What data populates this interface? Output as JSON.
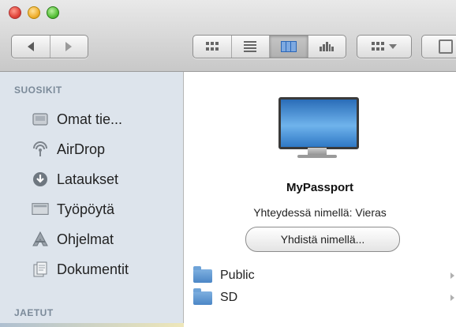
{
  "sidebar": {
    "favorites_header": "SUOSIKIT",
    "shared_header": "JAETUT",
    "items": [
      {
        "label": "Omat tie...",
        "icon": "home-icon"
      },
      {
        "label": "AirDrop",
        "icon": "airdrop-icon"
      },
      {
        "label": "Lataukset",
        "icon": "downloads-icon"
      },
      {
        "label": "Työpöytä",
        "icon": "desktop-icon"
      },
      {
        "label": "Ohjelmat",
        "icon": "applications-icon"
      },
      {
        "label": "Dokumentit",
        "icon": "documents-icon"
      }
    ]
  },
  "server": {
    "name": "MyPassport",
    "status": "Yhteydessä nimellä: Vieras",
    "connect_label": "Yhdistä nimellä..."
  },
  "files": [
    {
      "name": "Public"
    },
    {
      "name": "SD"
    }
  ],
  "colors": {
    "sidebar_bg": "#dde4ec",
    "section_header": "#7b8a99",
    "accent_blue": "#2a66b8"
  }
}
